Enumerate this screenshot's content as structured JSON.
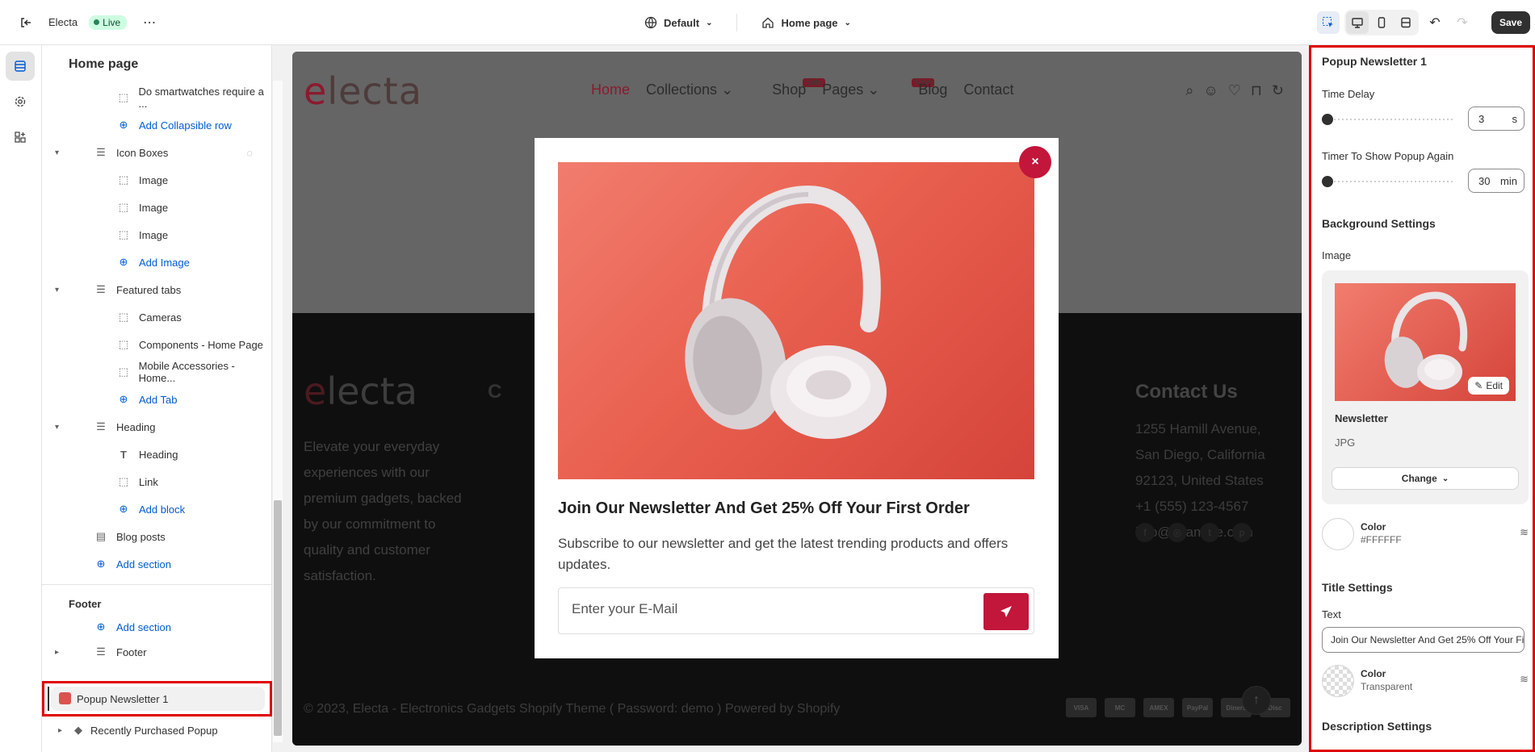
{
  "topbar": {
    "store_name": "Electa",
    "status": "Live",
    "theme_selector": "Default",
    "page_selector": "Home page",
    "save_label": "Save"
  },
  "sidebar": {
    "title": "Home page",
    "rows": [
      {
        "label": "Do smartwatches require a ...",
        "type": "block"
      },
      {
        "label": "Add Collapsible row",
        "type": "add"
      },
      {
        "label": "Icon Boxes",
        "type": "section"
      },
      {
        "label": "Image",
        "type": "block"
      },
      {
        "label": "Image",
        "type": "block"
      },
      {
        "label": "Image",
        "type": "block"
      },
      {
        "label": "Add Image",
        "type": "add"
      },
      {
        "label": "Featured tabs",
        "type": "section"
      },
      {
        "label": "Cameras",
        "type": "block"
      },
      {
        "label": "Components - Home Page",
        "type": "block"
      },
      {
        "label": "Mobile Accessories - Home...",
        "type": "block"
      },
      {
        "label": "Add Tab",
        "type": "add"
      },
      {
        "label": "Heading",
        "type": "section"
      },
      {
        "label": "Heading",
        "type": "text-block"
      },
      {
        "label": "Link",
        "type": "block"
      },
      {
        "label": "Add block",
        "type": "add"
      },
      {
        "label": "Blog posts",
        "type": "section-flat"
      },
      {
        "label": "Add section",
        "type": "add-section"
      }
    ],
    "footer_group_label": "Footer",
    "footer_add_section": "Add section",
    "footer_item": "Footer",
    "popup_item": "Popup Newsletter 1",
    "recently_item": "Recently Purchased Popup"
  },
  "preview": {
    "logo": "lecta",
    "nav": [
      "Home",
      "Collections",
      "Shop",
      "Pages",
      "Blog",
      "Contact"
    ],
    "badges": {
      "collections": "Sale",
      "pages": "New"
    },
    "footer_text": "Elevate your everyday experiences with our premium gadgets, backed by our commitment to quality and customer satisfaction.",
    "contact_heading": "Contact Us",
    "contact_lines": [
      "1255 Hamill Avenue,",
      "San Diego, California",
      "92123, United States",
      "+1 (555) 123-4567",
      "info@example.com"
    ],
    "copyright": "© 2023, Electa - Electronics Gadgets Shopify Theme ( Password: demo ) Powered by Shopify",
    "payments": [
      "VISA",
      "MC",
      "AMEX",
      "PayPal",
      "Diners",
      "Disc"
    ]
  },
  "modal": {
    "title": "Join Our Newsletter And Get 25% Off Your First Order",
    "description": "Subscribe to our newsletter and get the latest trending products and offers updates.",
    "email_placeholder": "Enter your E-Mail",
    "close_glyph": "×"
  },
  "panel": {
    "title": "Popup Newsletter 1",
    "time_delay_label": "Time Delay",
    "time_delay_value": "3",
    "time_delay_unit": "s",
    "timer_again_label": "Timer To Show Popup Again",
    "timer_again_value": "30",
    "timer_again_unit": "min",
    "background_heading": "Background Settings",
    "image_label": "Image",
    "image_name": "Newsletter",
    "image_type": "JPG",
    "edit_label": "Edit",
    "change_label": "Change",
    "bg_color_label": "Color",
    "bg_color_value": "#FFFFFF",
    "title_heading": "Title Settings",
    "text_label": "Text",
    "text_value": "Join Our Newsletter And Get 25% Off Your First Order",
    "title_color_label": "Color",
    "title_color_value": "Transparent",
    "description_heading": "Description Settings"
  },
  "colors": {
    "accent": "#c2163a",
    "highlight": "#e00000",
    "link": "#005bd3"
  }
}
